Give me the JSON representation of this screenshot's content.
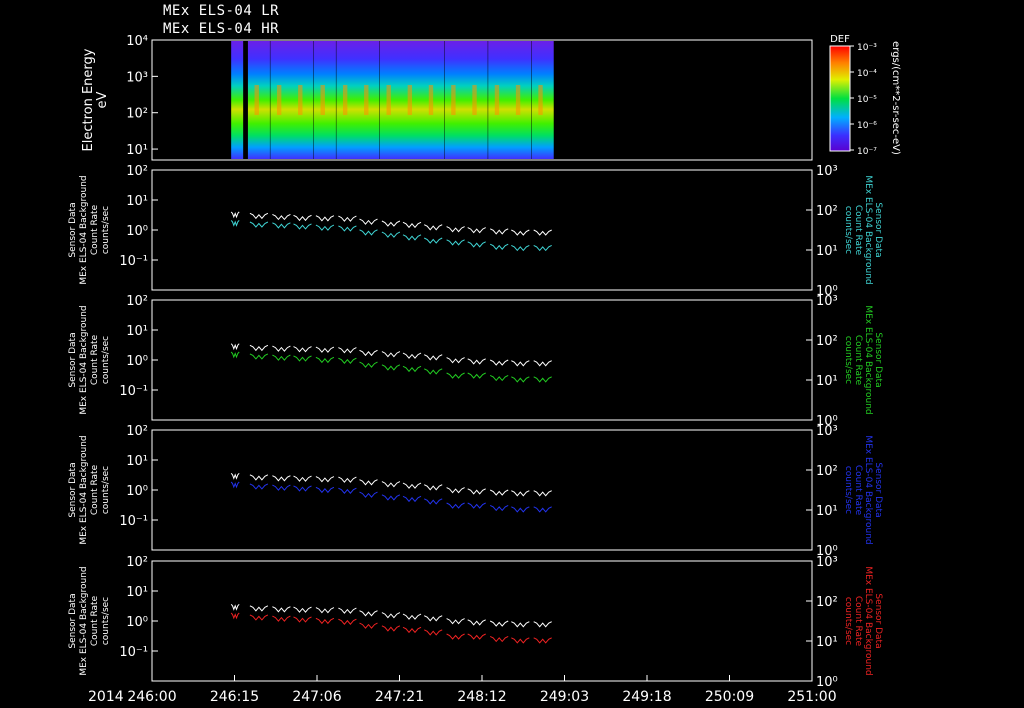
{
  "titles": [
    "MEx ELS-04 LR",
    "MEx ELS-04 HR"
  ],
  "colorbar": {
    "label": "DEF",
    "side_label": "ergs/(cm**2-sr-sec-eV)",
    "ticks": [
      "10⁻³",
      "10⁻⁴",
      "10⁻⁵",
      "10⁻⁶",
      "10⁻⁷"
    ]
  },
  "spectrogram": {
    "ylabel_line1": "Electron Energy",
    "ylabel_line2": "eV",
    "yticks": [
      "10⁴",
      "10³",
      "10²",
      "10¹"
    ]
  },
  "panels": [
    {
      "left_label": [
        "Sensor Data",
        "MEx ELS-04 Background",
        "Count Rate",
        "counts/sec"
      ],
      "right_label": [
        "Sensor Data",
        "MEx ELS-04 Background",
        "Count Rate",
        "counts/sec"
      ],
      "color": "#3fd4d4"
    },
    {
      "left_label": [
        "Sensor Data",
        "MEx ELS-04 Background",
        "Count Rate",
        "counts/sec"
      ],
      "right_label": [
        "Sensor Data",
        "MEx ELS-04 Background",
        "Count Rate",
        "counts/sec"
      ],
      "color": "#22cc22"
    },
    {
      "left_label": [
        "Sensor Data",
        "MEx ELS-04 Background",
        "Count Rate",
        "counts/sec"
      ],
      "right_label": [
        "Sensor Data",
        "MEx ELS-04 Background",
        "Count Rate",
        "counts/sec"
      ],
      "color": "#2233ee"
    },
    {
      "left_label": [
        "Sensor Data",
        "MEx ELS-04 Background",
        "Count Rate",
        "counts/sec"
      ],
      "right_label": [
        "Sensor Data",
        "MEx ELS-04 Background",
        "Count Rate",
        "counts/sec"
      ],
      "color": "#ee2222"
    }
  ],
  "left_yticks": [
    "10²",
    "10¹",
    "10⁰",
    "10⁻¹"
  ],
  "right_yticks": [
    "10³",
    "10²",
    "10¹",
    "10⁰"
  ],
  "xaxis": {
    "year": "2014",
    "ticks": [
      "246:00",
      "246:15",
      "247:06",
      "247:21",
      "248:12",
      "249:03",
      "249:18",
      "250:09",
      "251:00"
    ]
  },
  "chart_data": {
    "type": "line",
    "x_unit": "day-of-year:hour",
    "x_range": [
      "246:00",
      "251:00"
    ],
    "left_ylim": [
      0.01,
      100
    ],
    "right_ylim": [
      1,
      1000
    ],
    "left_yscale": "log",
    "right_yscale": "log",
    "spectrogram_ylim_eV": [
      5,
      10000
    ],
    "colorbar_range": [
      1e-07,
      0.001
    ],
    "orbit_windows_doy": [
      246.63,
      246.81,
      246.98,
      247.14,
      247.31,
      247.48,
      247.64,
      247.81,
      247.97,
      248.13,
      248.3,
      248.46,
      248.63,
      248.79,
      248.96
    ],
    "series": [
      {
        "panel": 1,
        "axis": "right",
        "values": [
          55,
          50,
          48,
          45,
          42,
          40,
          32,
          28,
          24,
          20,
          18,
          16,
          14,
          13,
          13
        ]
      },
      {
        "panel": 1,
        "axis": "left",
        "values": [
          4.0,
          3.6,
          3.3,
          3.1,
          3.0,
          2.9,
          2.3,
          2.0,
          1.8,
          1.5,
          1.3,
          1.2,
          1.1,
          1.0,
          1.0
        ]
      },
      {
        "panel": 2,
        "axis": "right",
        "values": [
          50,
          45,
          42,
          40,
          37,
          35,
          28,
          24,
          22,
          19,
          15,
          15,
          13,
          12,
          12
        ]
      },
      {
        "panel": 2,
        "axis": "left",
        "values": [
          3.5,
          3.1,
          2.9,
          2.8,
          2.7,
          2.6,
          2.1,
          1.9,
          1.7,
          1.5,
          1.2,
          1.1,
          1.0,
          0.95,
          0.95
        ]
      },
      {
        "panel": 3,
        "axis": "right",
        "values": [
          50,
          45,
          42,
          40,
          37,
          35,
          28,
          24,
          22,
          19,
          15,
          15,
          13,
          12,
          12
        ]
      },
      {
        "panel": 3,
        "axis": "left",
        "values": [
          3.6,
          3.2,
          3.0,
          2.9,
          2.8,
          2.7,
          2.2,
          1.9,
          1.7,
          1.5,
          1.2,
          1.1,
          1.0,
          0.95,
          0.95
        ]
      },
      {
        "panel": 4,
        "axis": "right",
        "values": [
          50,
          45,
          42,
          40,
          37,
          35,
          28,
          24,
          22,
          19,
          15,
          15,
          13,
          12,
          12
        ]
      },
      {
        "panel": 4,
        "axis": "left",
        "values": [
          3.6,
          3.2,
          3.0,
          2.9,
          2.8,
          2.7,
          2.2,
          1.9,
          1.7,
          1.5,
          1.2,
          1.1,
          1.0,
          0.95,
          0.95
        ]
      }
    ]
  }
}
